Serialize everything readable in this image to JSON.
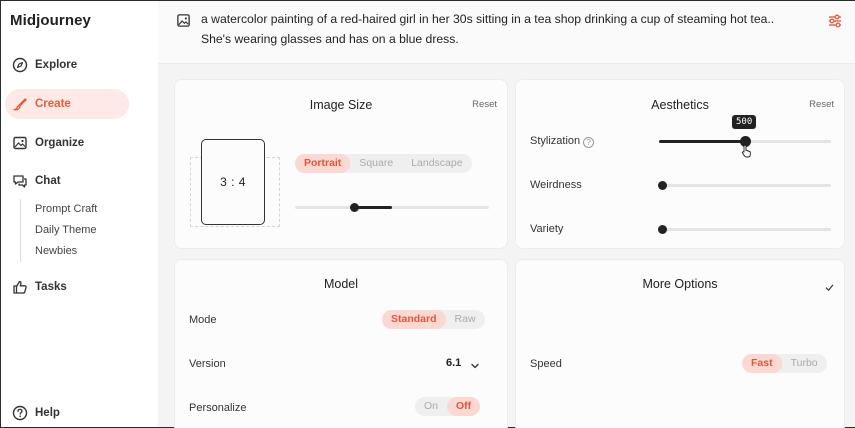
{
  "sidebar": {
    "logo": "Midjourney",
    "nav": {
      "explore": "Explore",
      "create": "Create",
      "organize": "Organize",
      "chat": "Chat",
      "tasks": "Tasks",
      "help": "Help"
    },
    "chat_sub": [
      "Prompt Craft",
      "Daily Theme",
      "Newbies"
    ]
  },
  "prompt": {
    "line1": "a watercolor painting of a red-haired girl in her 30s sitting in a tea shop drinking a cup of steaming hot tea..",
    "line2": "She's wearing glasses and has on a blue dress."
  },
  "image_size": {
    "title": "Image Size",
    "reset": "Reset",
    "ratio": "3 : 4",
    "orientations": [
      "Portrait",
      "Square",
      "Landscape"
    ],
    "selected_orientation": "Portrait",
    "size_slider": 0.45
  },
  "aesthetics": {
    "title": "Aesthetics",
    "reset": "Reset",
    "stylization_label": "Stylization",
    "stylization_value": "500",
    "stylization_fraction": 0.5,
    "weirdness_label": "Weirdness",
    "weirdness_fraction": 0.0,
    "variety_label": "Variety",
    "variety_fraction": 0.0
  },
  "model": {
    "title": "Model",
    "mode_label": "Mode",
    "mode_options": [
      "Standard",
      "Raw"
    ],
    "mode_selected": "Standard",
    "version_label": "Version",
    "version_value": "6.1",
    "personalize_label": "Personalize",
    "personalize_options": [
      "On",
      "Off"
    ],
    "personalize_selected": "Off"
  },
  "more_options": {
    "title": "More Options",
    "speed_label": "Speed",
    "speed_options": [
      "Fast",
      "Turbo"
    ],
    "speed_selected": "Fast"
  },
  "colors": {
    "accent": "#e85a3c",
    "accent_bg": "#fbd9d2",
    "active_nav_bg": "#fde9e6"
  }
}
